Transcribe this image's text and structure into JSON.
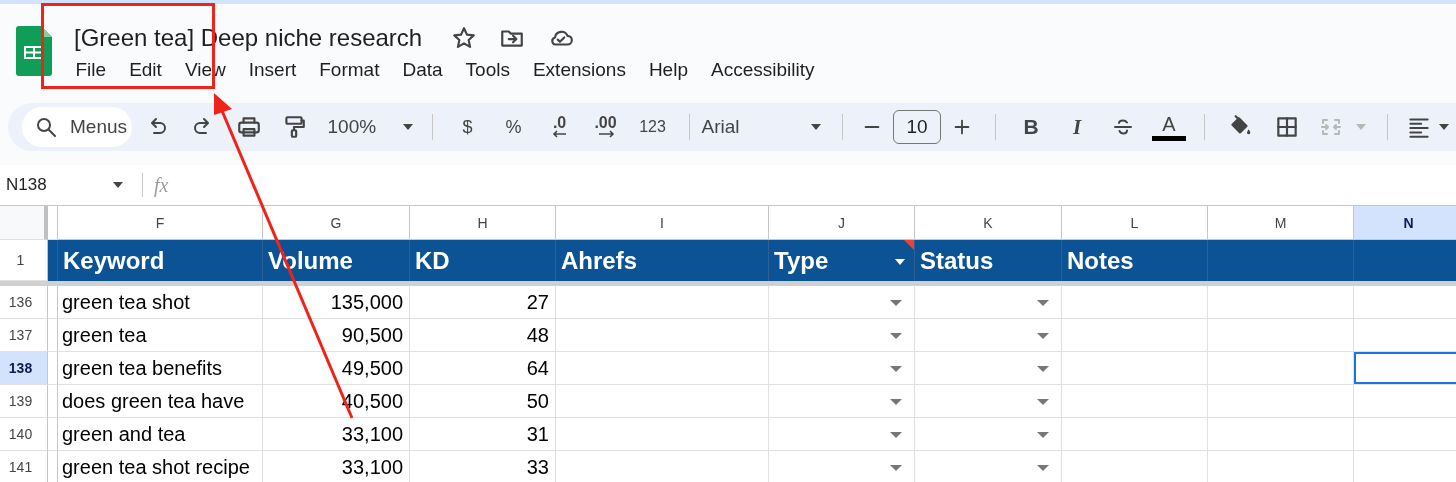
{
  "document": {
    "title": "[Green tea] Deep niche research"
  },
  "menus": [
    "File",
    "Edit",
    "View",
    "Insert",
    "Format",
    "Data",
    "Tools",
    "Extensions",
    "Help",
    "Accessibility"
  ],
  "toolbar": {
    "search_label": "Menus",
    "zoom": "100%",
    "currency": "$",
    "percent": "%",
    "decrease_decimals": ".0",
    "increase_decimals": ".00",
    "number_format": "123",
    "font": "Arial",
    "font_size": "10",
    "bold": "B",
    "italic": "I",
    "text_color": "A",
    "merge_disabled": true
  },
  "formula_bar": {
    "cell_reference": "N138",
    "formula_label": "fx"
  },
  "columns": [
    {
      "letter": "F",
      "kind": "text",
      "selected": false
    },
    {
      "letter": "G",
      "kind": "number",
      "selected": false
    },
    {
      "letter": "H",
      "kind": "number",
      "selected": false
    },
    {
      "letter": "I",
      "kind": "blank",
      "selected": false
    },
    {
      "letter": "J",
      "kind": "dropdown",
      "selected": false
    },
    {
      "letter": "K",
      "kind": "dropdown",
      "selected": false
    },
    {
      "letter": "L",
      "kind": "blank",
      "selected": false
    },
    {
      "letter": "M",
      "kind": "blank",
      "selected": false
    },
    {
      "letter": "N",
      "kind": "blank",
      "selected": true
    }
  ],
  "header_row": {
    "number": "1",
    "cells": [
      {
        "text": "Keyword",
        "filter": false,
        "note": false
      },
      {
        "text": "Volume",
        "filter": false,
        "note": false
      },
      {
        "text": "KD",
        "filter": false,
        "note": false
      },
      {
        "text": "Ahrefs",
        "filter": false,
        "note": false
      },
      {
        "text": "Type",
        "filter": true,
        "note": true
      },
      {
        "text": "Status",
        "filter": false,
        "note": false
      },
      {
        "text": "Notes",
        "filter": false,
        "note": false
      }
    ]
  },
  "rows": [
    {
      "number": "136",
      "selected": false,
      "cells": [
        "green tea shot",
        "135,000",
        "27"
      ]
    },
    {
      "number": "137",
      "selected": false,
      "cells": [
        "green tea",
        "90,500",
        "48"
      ]
    },
    {
      "number": "138",
      "selected": true,
      "cells": [
        "green tea benefits",
        "49,500",
        "64"
      ]
    },
    {
      "number": "139",
      "selected": false,
      "cells": [
        "does green tea have",
        "40,500",
        "50"
      ]
    },
    {
      "number": "140",
      "selected": false,
      "cells": [
        "green and tea",
        "33,100",
        "31"
      ]
    },
    {
      "number": "141",
      "selected": false,
      "cells": [
        "green tea shot recipe",
        "33,100",
        "33"
      ]
    }
  ],
  "annotations": [
    {
      "kind": "box"
    },
    {
      "kind": "arrow"
    }
  ]
}
